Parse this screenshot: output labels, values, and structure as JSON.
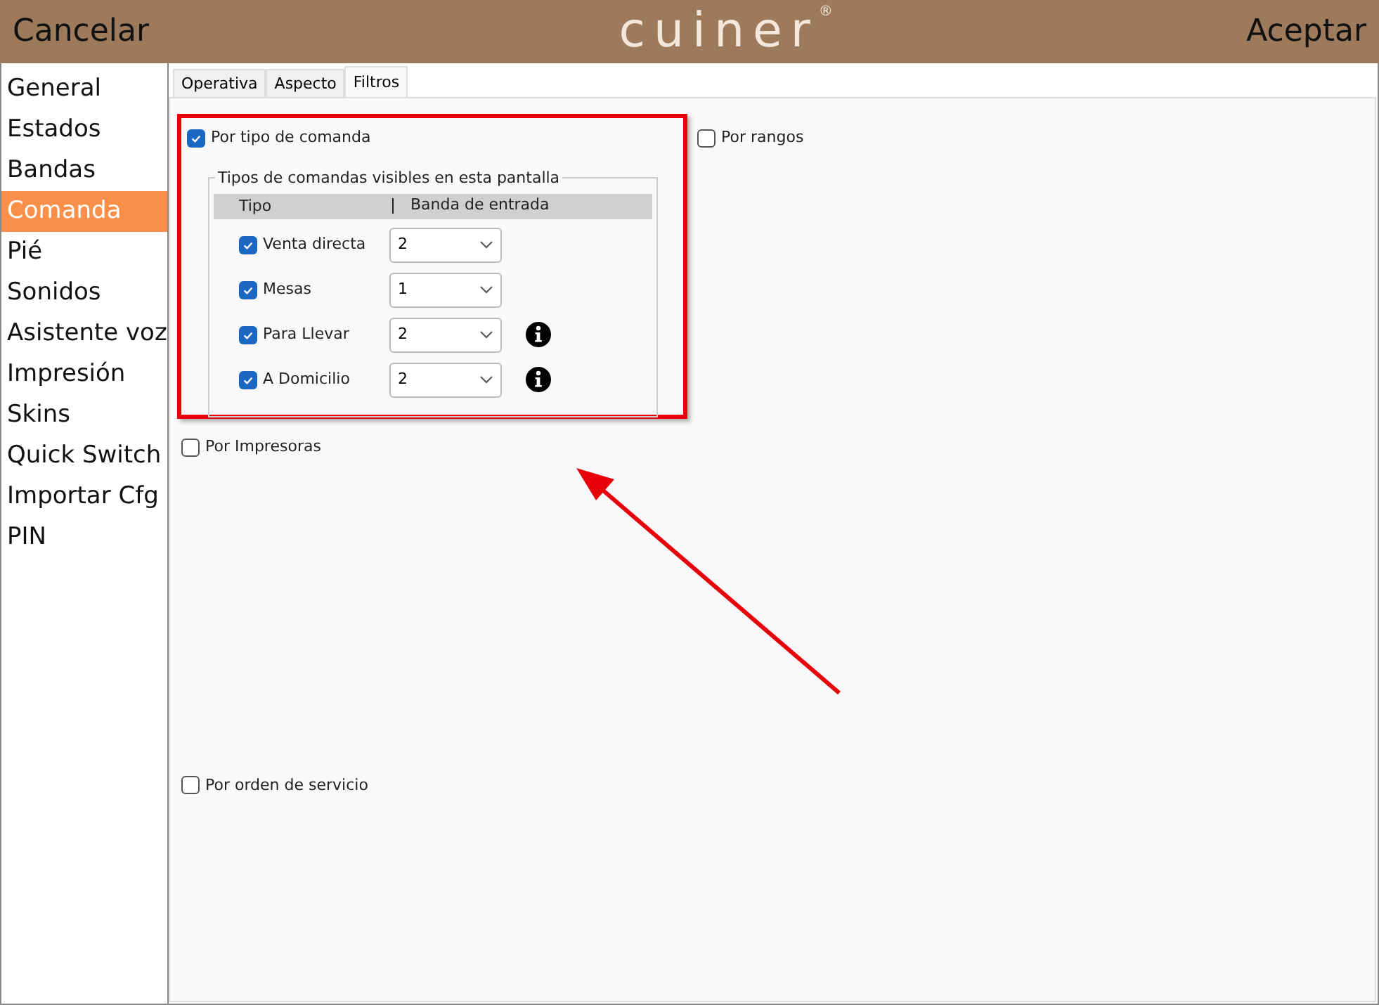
{
  "header": {
    "cancel": "Cancelar",
    "logo": "cuiner",
    "logo_mark": "®",
    "accept": "Aceptar"
  },
  "sidebar": {
    "items": [
      {
        "label": "General",
        "selected": false
      },
      {
        "label": "Estados",
        "selected": false
      },
      {
        "label": "Bandas",
        "selected": false
      },
      {
        "label": "Comanda",
        "selected": true
      },
      {
        "label": "Pié",
        "selected": false
      },
      {
        "label": "Sonidos",
        "selected": false
      },
      {
        "label": "Asistente voz",
        "selected": false
      },
      {
        "label": "Impresión",
        "selected": false
      },
      {
        "label": "Skins",
        "selected": false
      },
      {
        "label": "Quick Switch",
        "selected": false
      },
      {
        "label": "Importar Cfg",
        "selected": false
      },
      {
        "label": "PIN",
        "selected": false
      }
    ]
  },
  "tabs": [
    {
      "label": "Operativa",
      "selected": false
    },
    {
      "label": "Aspecto",
      "selected": false
    },
    {
      "label": "Filtros",
      "selected": true
    }
  ],
  "filters": {
    "by_type": {
      "label": "Por tipo de comanda",
      "checked": true,
      "highlighted": true
    },
    "by_range": {
      "label": "Por rangos",
      "checked": false
    },
    "group": {
      "title": "Tipos de comandas visibles en esta pantalla",
      "columns": [
        "Tipo",
        "Banda de entrada"
      ],
      "rows": [
        {
          "label": "Venta directa",
          "checked": true,
          "band": "2",
          "info": false
        },
        {
          "label": "Mesas",
          "checked": true,
          "band": "1",
          "info": false
        },
        {
          "label": "Para Llevar",
          "checked": true,
          "band": "2",
          "info": true
        },
        {
          "label": "A Domicilio",
          "checked": true,
          "band": "2",
          "info": true
        }
      ]
    },
    "by_printers": {
      "label": "Por Impresoras",
      "checked": false
    },
    "by_service_order": {
      "label": "Por orden de servicio",
      "checked": false
    }
  }
}
